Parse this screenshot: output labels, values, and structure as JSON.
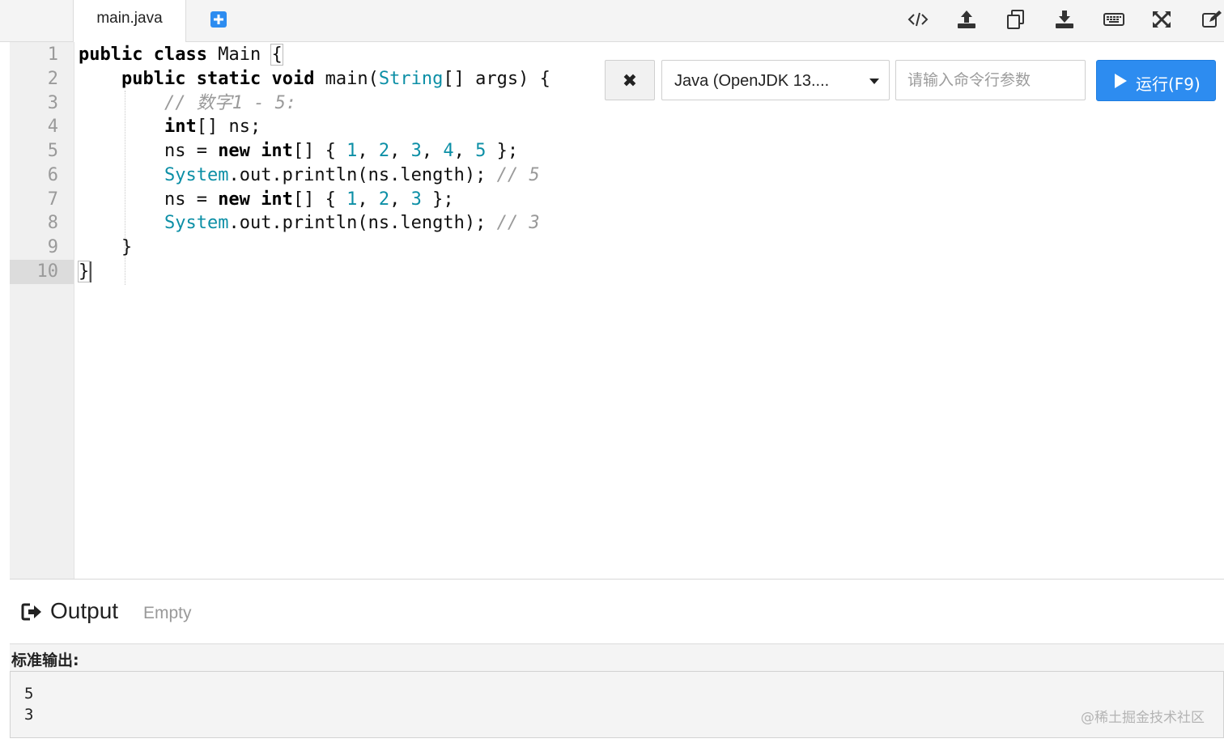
{
  "tabs": [
    {
      "label": "main.java",
      "active": true
    }
  ],
  "toolbar": {
    "icons": [
      "code-icon",
      "upload-icon",
      "copy-icon",
      "download-icon",
      "keyboard-icon",
      "fullscreen-icon",
      "edit-icon"
    ]
  },
  "editor": {
    "line_numbers": [
      "1",
      "2",
      "3",
      "4",
      "5",
      "6",
      "7",
      "8",
      "9",
      "10"
    ],
    "active_line": 10,
    "lines": [
      "public class Main {",
      "    public static void main(String[] args) {",
      "        // 数字1 - 5:",
      "        int[] ns;",
      "        ns = new int[] { 1, 2, 3, 4, 5 };",
      "        System.out.println(ns.length); // 5",
      "        ns = new int[] { 1, 2, 3 };",
      "        System.out.println(ns.length); // 3",
      "    }",
      "}"
    ]
  },
  "run_controls": {
    "close_label": "✖",
    "language": "Java (OpenJDK 13....",
    "args_placeholder": "请输入命令行参数",
    "run_label": "运行(F9)",
    "accent_color": "#2d8cf0"
  },
  "output": {
    "title": "Output",
    "status": "Empty",
    "stdout_label": "标准输出:",
    "stdout_lines": [
      "5",
      "3"
    ]
  },
  "watermark": "@稀土掘金技术社区"
}
